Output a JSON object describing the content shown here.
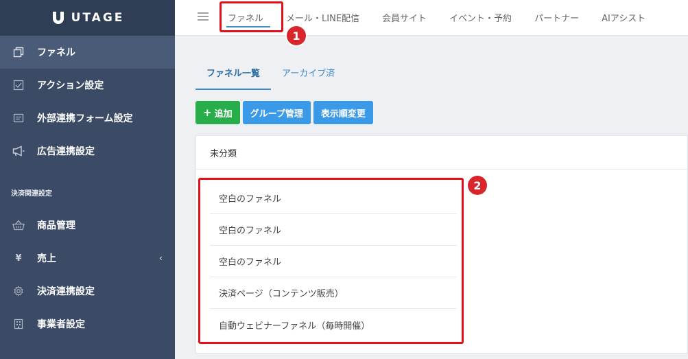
{
  "app": {
    "logo_text": "UTAGE"
  },
  "sidebar": {
    "items": [
      {
        "label": "ファネル",
        "icon": "copy-icon",
        "active": true
      },
      {
        "label": "アクション設定",
        "icon": "checkbox-icon"
      },
      {
        "label": "外部連携フォーム設定",
        "icon": "form-icon"
      },
      {
        "label": "広告連携設定",
        "icon": "megaphone-icon"
      }
    ],
    "section_label": "決済関連設定",
    "payment_items": [
      {
        "label": "商品管理",
        "icon": "basket-icon"
      },
      {
        "label": "売上",
        "icon": "yen-icon"
      },
      {
        "label": "決済連携設定",
        "icon": "gear-icon"
      },
      {
        "label": "事業者設定",
        "icon": "building-icon"
      }
    ]
  },
  "topbar": {
    "tabs": [
      {
        "label": "ファネル",
        "active": true
      },
      {
        "label": "メール・LINE配信"
      },
      {
        "label": "会員サイト"
      },
      {
        "label": "イベント・予約"
      },
      {
        "label": "パートナー"
      },
      {
        "label": "AIアシスト"
      }
    ]
  },
  "subtabs": [
    {
      "label": "ファネル一覧",
      "active": true
    },
    {
      "label": "アーカイブ済"
    }
  ],
  "buttons": {
    "add": "追加",
    "group": "グループ管理",
    "order": "表示順変更"
  },
  "panel": {
    "header": "未分類",
    "items": [
      "空白のファネル",
      "空白のファネル",
      "空白のファネル",
      "決済ページ（コンテンツ販売）",
      "自動ウェビナーファネル（毎時開催）"
    ]
  },
  "annotations": {
    "badge1": "1",
    "badge2": "2",
    "highlight_color": "#e3101a"
  }
}
